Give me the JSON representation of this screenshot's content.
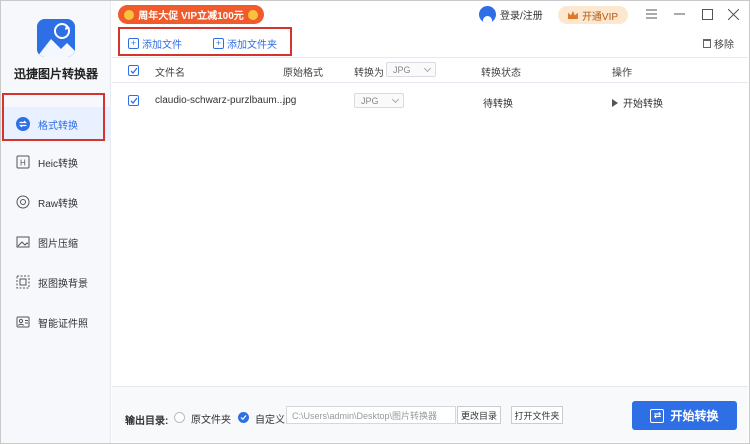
{
  "app": {
    "title": "迅捷图片转换器",
    "accent": "#2f6fe6",
    "highlight_border": "#d6332f"
  },
  "promo": {
    "text": "周年大促 VIP立减100元"
  },
  "header": {
    "login_label": "登录/注册",
    "vip_label": "开通VIP",
    "controls": [
      "menu-icon",
      "minimize-icon",
      "maximize-icon",
      "close-icon"
    ]
  },
  "sidebar": {
    "items": [
      {
        "label": "格式转换",
        "icon": "swap-icon",
        "active": true
      },
      {
        "label": "Heic转换",
        "icon": "heic-icon",
        "active": false
      },
      {
        "label": "Raw转换",
        "icon": "camera-icon",
        "active": false
      },
      {
        "label": "图片压缩",
        "icon": "image-icon",
        "active": false
      },
      {
        "label": "抠图换背景",
        "icon": "cutout-icon",
        "active": false
      },
      {
        "label": "智能证件照",
        "icon": "id-photo-icon",
        "active": false
      }
    ]
  },
  "toolbar": {
    "add_file": "添加文件",
    "add_folder": "添加文件夹",
    "remove": "移除"
  },
  "table": {
    "headers": {
      "filename": "文件名",
      "original_format": "原始格式",
      "convert_to": "转换为",
      "status": "转换状态",
      "action": "操作"
    },
    "header_format_select": "JPG",
    "rows": [
      {
        "checked": true,
        "filename": "claudio-schwarz-purzlbaum...",
        "original_format": "jpg",
        "target_format": "JPG",
        "status": "待转换",
        "action": "开始转换"
      }
    ]
  },
  "footer": {
    "output_label": "输出目录:",
    "option_original": "原文件夹",
    "option_custom": "自定义",
    "selected_option": "自定义",
    "path": "C:\\Users\\admin\\Desktop\\图片转换器",
    "change_dir": "更改目录",
    "open_folder": "打开文件夹",
    "start": "开始转换"
  }
}
